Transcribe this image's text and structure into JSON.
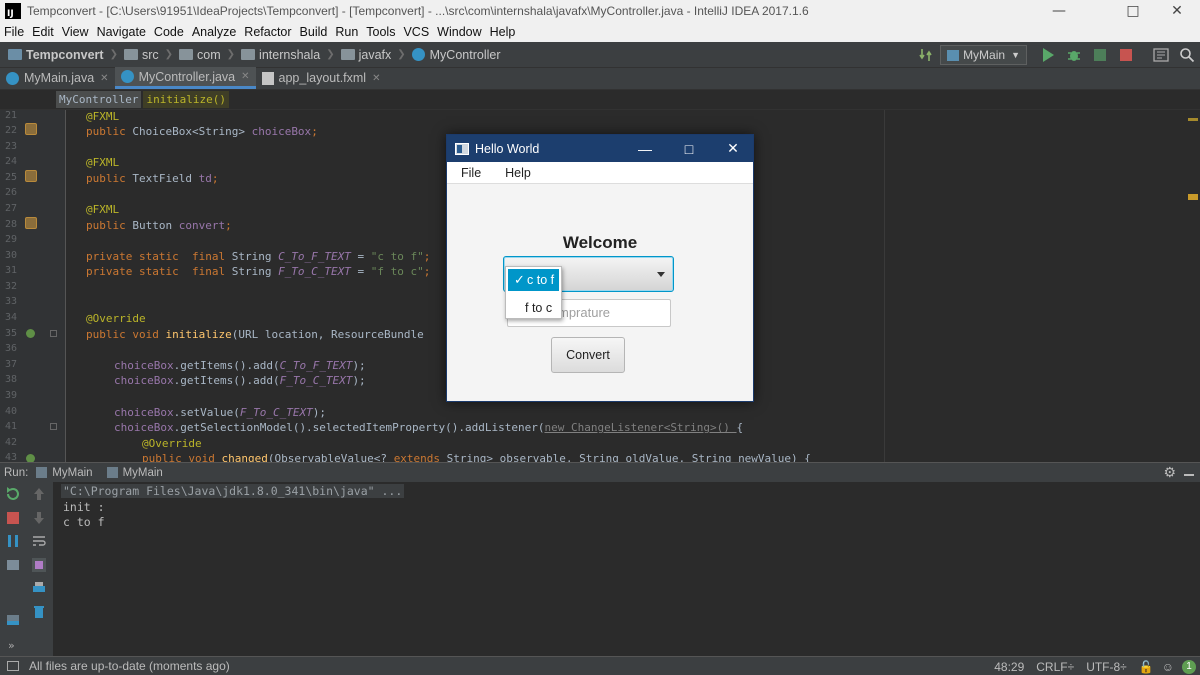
{
  "window": {
    "title": "Tempconvert - [C:\\Users\\91951\\IdeaProjects\\Tempconvert] - [Tempconvert] - ...\\src\\com\\internshala\\javafx\\MyController.java - IntelliJ IDEA 2017.1.6",
    "logo": "IJ"
  },
  "menu": [
    "File",
    "Edit",
    "View",
    "Navigate",
    "Code",
    "Analyze",
    "Refactor",
    "Build",
    "Run",
    "Tools",
    "VCS",
    "Window",
    "Help"
  ],
  "breadcrumbs": [
    "Tempconvert",
    "src",
    "com",
    "internshala",
    "javafx",
    "MyController"
  ],
  "run_config": "MyMain",
  "tabs": [
    {
      "label": "MyMain.java",
      "icon": "java-class-icon"
    },
    {
      "label": "MyController.java",
      "icon": "java-class-icon"
    },
    {
      "label": "app_layout.fxml",
      "icon": "fxml-file-icon"
    }
  ],
  "code_crumbs": [
    "MyController",
    "initialize()"
  ],
  "editor": {
    "line_numbers": [
      "21",
      "22",
      "23",
      "24",
      "25",
      "26",
      "27",
      "28",
      "29",
      "30",
      "31",
      "32",
      "33",
      "34",
      "35",
      "36",
      "37",
      "38",
      "39",
      "40",
      "41",
      "42",
      "43"
    ],
    "lines": {
      "l21": "@FXML",
      "l22_kw": "public ",
      "l22_t": "ChoiceBox<String> ",
      "l22_f": "choiceBox",
      "l22_e": ";",
      "l24": "@FXML",
      "l25_kw": "public ",
      "l25_t": "TextField ",
      "l25_f": "td",
      "l25_e": ";",
      "l27": "@FXML",
      "l28_kw": "public ",
      "l28_t": "Button ",
      "l28_f": "convert",
      "l28_e": ";",
      "l30_kw": "private static  final ",
      "l30_t": "String ",
      "l30_f": "C_To_F_TEXT",
      "l30_eq": " = ",
      "l30_s": "\"c to f\"",
      "l30_e": ";",
      "l31_kw": "private static  final ",
      "l31_t": "String ",
      "l31_f": "F_To_C_TEXT",
      "l31_eq": " = ",
      "l31_s": "\"f to c\"",
      "l31_e": ";",
      "l34": "@Override",
      "l35_kw": "public void ",
      "l35_m": "initialize",
      "l35_rest": "(URL location, ResourceBundle ",
      "l37_f": "choiceBox",
      "l37_a": ".getItems().add(",
      "l37_c": "C_To_F_TEXT",
      "l37_e": ");",
      "l38_f": "choiceBox",
      "l38_a": ".getItems().add(",
      "l38_c": "F_To_C_TEXT",
      "l38_e": ");",
      "l40_f": "choiceBox",
      "l40_a": ".setValue(",
      "l40_c": "F_To_C_TEXT",
      "l40_e": ");",
      "l41_f": "choiceBox",
      "l41_a": ".getSelectionModel().selectedItemProperty().addListener(",
      "l41_n": "new ChangeListener<String>() ",
      "l41_e": "{",
      "l42": "@Override",
      "l43_kw": "public void ",
      "l43_m": "changed",
      "l43_rest": "(ObservableValue<? ",
      "l43_kw2": "extends ",
      "l43_rest2": "String> observable, String oldValue, String newValue) {"
    }
  },
  "run_panel": {
    "label": "Run:",
    "tabs": [
      "MyMain",
      "MyMain"
    ],
    "console": [
      "\"C:\\Program Files\\Java\\jdk1.8.0_341\\bin\\java\" ...",
      "init :",
      "c to f"
    ]
  },
  "status": {
    "message": "All files are up-to-date (moments ago)",
    "position": "48:29",
    "line_sep": "CRLF÷",
    "encoding": "UTF-8÷"
  },
  "fx_app": {
    "title": "Hello World",
    "menu": [
      "File",
      "Help"
    ],
    "heading": "Welcome",
    "dropdown_items": [
      {
        "label": "c to f",
        "selected": true
      },
      {
        "label": "f to c",
        "selected": false
      }
    ],
    "input_placeholder": "Enter Temprature",
    "input_visible_text": "mprature",
    "button": "Convert"
  },
  "colors": {
    "accent": "#0096c9",
    "fx_title_bg": "#1c3e6e",
    "ide_bg": "#2b2b2b"
  }
}
